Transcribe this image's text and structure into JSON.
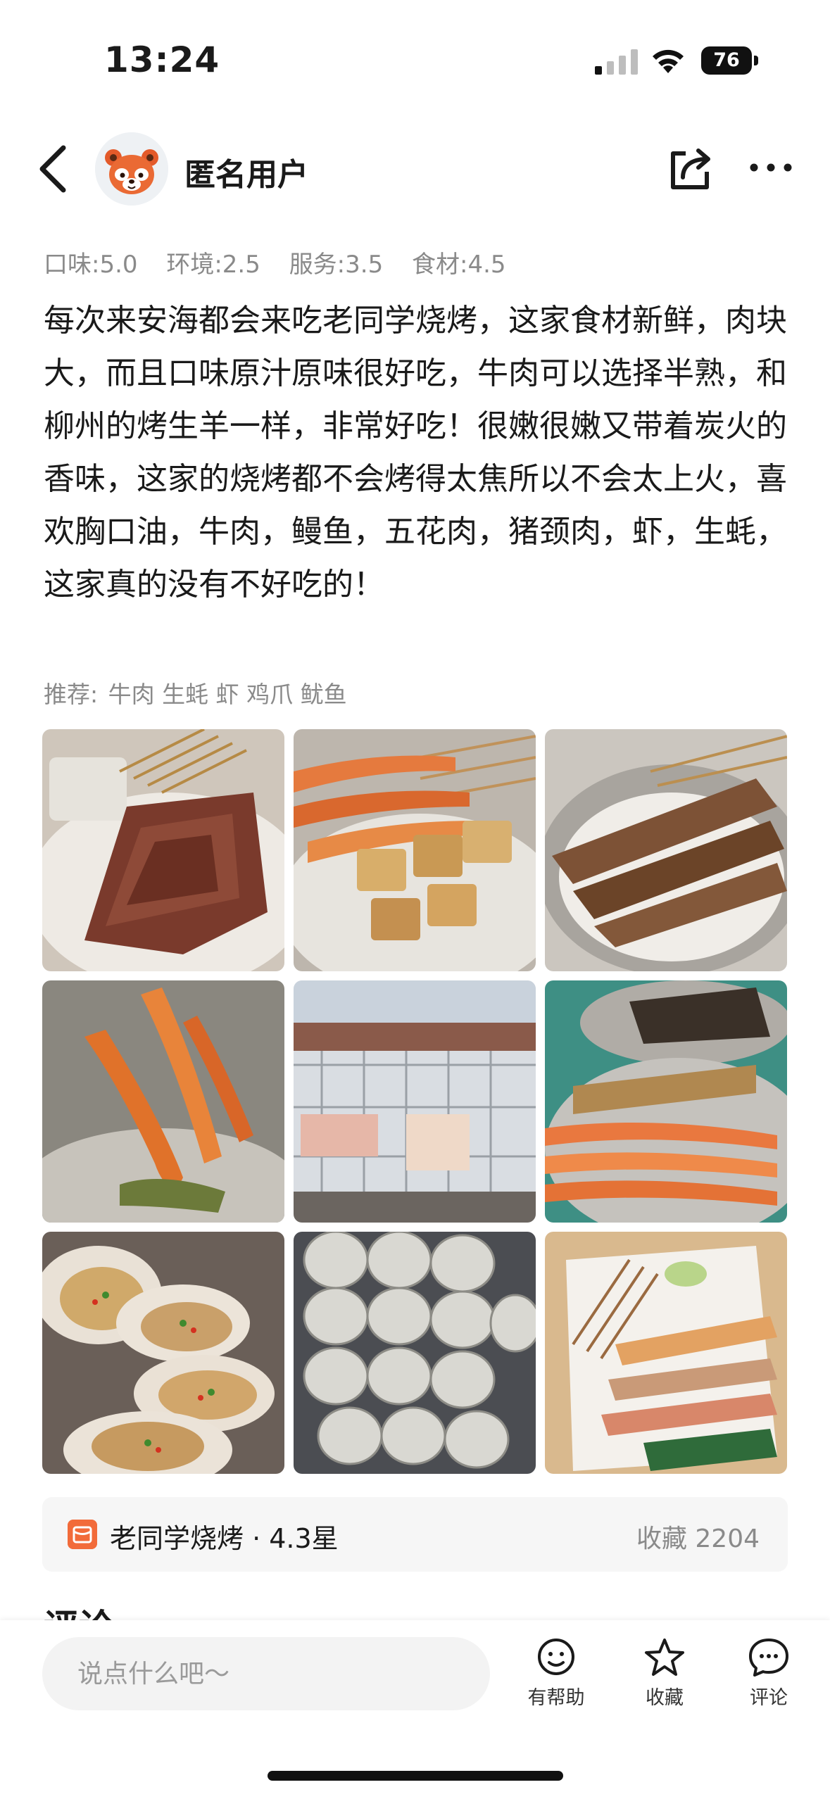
{
  "status_bar": {
    "time": "13:24",
    "battery": "76"
  },
  "header": {
    "user_name": "匿名用户",
    "avatar_icon": "red-panda-avatar",
    "back_icon": "chevron-left-icon",
    "share_icon": "share-icon",
    "more_icon": "more-dots-icon"
  },
  "ratings": {
    "taste": "口味:5.0",
    "environment": "环境:2.5",
    "service": "服务:3.5",
    "ingredients": "食材:4.5"
  },
  "review": {
    "text": "每次来安海都会来吃老同学烧烤，这家食材新鲜，肉块大，而且口味原汁原味很好吃，牛肉可以选择半熟，和柳州的烤生羊一样，非常好吃！很嫩很嫩又带着炭火的香味，这家的烧烤都不会烤得太焦所以不会太上火，喜欢胸口油，牛肉，鳗鱼，五花肉，猪颈肉，虾，生蚝，这家真的没有不好吃的！"
  },
  "recommend": {
    "label": "推荐:",
    "tags": "牛肉 生蚝 虾 鸡爪 鱿鱼"
  },
  "photos": [
    "beef-skewers-photo",
    "shrimp-tofu-skewers-photo",
    "meat-skewers-photo",
    "grilled-shrimp-photo",
    "skewer-display-fridge-photo",
    "eel-shrimp-plate-photo",
    "grilled-oysters-photo",
    "raw-oysters-photo",
    "skewer-basket-photo"
  ],
  "shop": {
    "name": "老同学烧烤 · 4.3星",
    "favorites": "收藏 2204",
    "accent": "#f26b3a"
  },
  "comments": {
    "heading": "评论"
  },
  "bottom_bar": {
    "input_placeholder": "说点什么吧～",
    "helpful_label": "有帮助",
    "favorite_label": "收藏",
    "comment_label": "评论"
  }
}
